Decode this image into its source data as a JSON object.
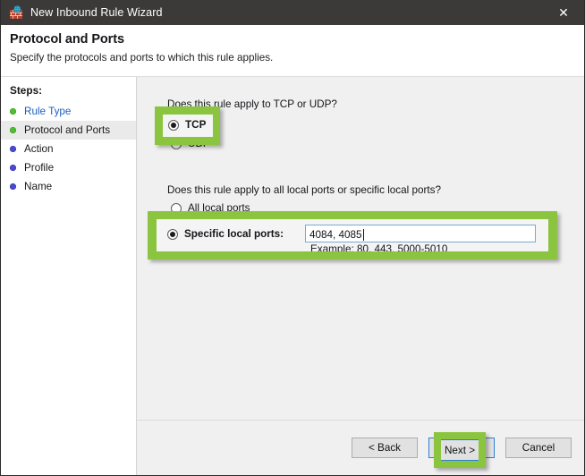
{
  "window": {
    "title": "New Inbound Rule Wizard",
    "icon": "firewall-icon",
    "close_label": "✕"
  },
  "header": {
    "title": "Protocol and Ports",
    "subtitle": "Specify the protocols and ports to which this rule applies."
  },
  "sidebar": {
    "heading": "Steps:",
    "items": [
      {
        "label": "Rule Type",
        "state": "done",
        "style": "link"
      },
      {
        "label": "Protocol and Ports",
        "state": "done",
        "style": "current"
      },
      {
        "label": "Action",
        "state": "todo",
        "style": "plain"
      },
      {
        "label": "Profile",
        "state": "todo",
        "style": "plain"
      },
      {
        "label": "Name",
        "state": "todo",
        "style": "plain"
      }
    ]
  },
  "main": {
    "question_protocol": "Does this rule apply to TCP or UDP?",
    "question_ports": "Does this rule apply to all local ports or specific local ports?",
    "protocol_options": [
      {
        "label": "TCP",
        "checked": true
      },
      {
        "label": "UDP",
        "checked": false
      }
    ],
    "port_options": [
      {
        "label": "All local ports",
        "checked": false
      },
      {
        "label": "Specific local ports:",
        "checked": true
      }
    ],
    "ports_input": {
      "value": "4084, 4085",
      "placeholder": "",
      "hint": "Example: 80, 443, 5000-5010"
    }
  },
  "footer": {
    "back_label": "< Back",
    "next_label": "Next >",
    "cancel_label": "Cancel"
  },
  "annotations": {
    "color": "#8bc53f",
    "boxes": [
      {
        "name": "tcp-radio",
        "target": "TCP"
      },
      {
        "name": "specific-local-ports",
        "target": "Specific local ports"
      },
      {
        "name": "next-button",
        "target": "Next >"
      }
    ]
  }
}
